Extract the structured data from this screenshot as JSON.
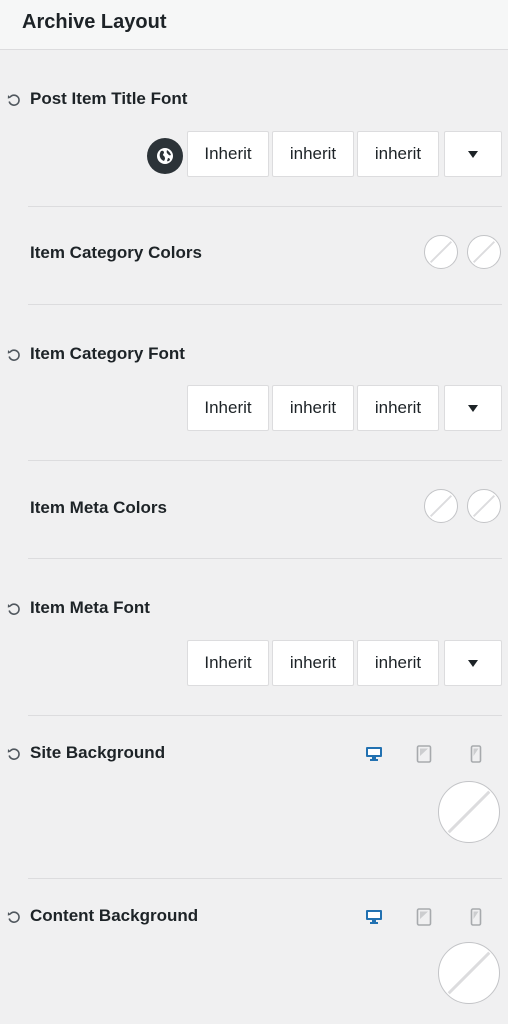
{
  "header": {
    "title": "Archive Layout"
  },
  "font_values": {
    "family": "Inherit",
    "size": "inherit",
    "line_height": "inherit"
  },
  "sections": {
    "post_item_title_font": {
      "label": "Post Item Title Font"
    },
    "item_category_colors": {
      "label": "Item Category Colors"
    },
    "item_category_font": {
      "label": "Item Category Font"
    },
    "item_meta_colors": {
      "label": "Item Meta Colors"
    },
    "item_meta_font": {
      "label": "Item Meta Font"
    },
    "site_background": {
      "label": "Site Background"
    },
    "content_background": {
      "label": "Content Background"
    }
  },
  "icons": {
    "reset": "reset-icon",
    "globe": "globe-icon",
    "dropdown": "caret-down-icon",
    "desktop": "desktop-icon",
    "tablet": "tablet-icon",
    "mobile": "mobile-icon"
  },
  "colors": {
    "active_device": "#2271b1",
    "inactive_device": "#a7aaad",
    "swatch_slash": "#dcdcde"
  }
}
